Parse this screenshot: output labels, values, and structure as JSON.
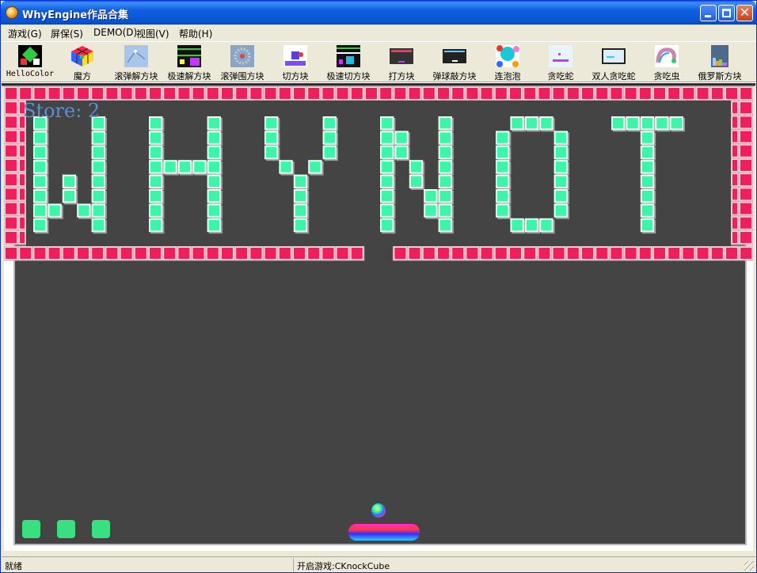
{
  "window": {
    "title": "WhyEngine作品合集"
  },
  "menu": [
    "游戏(G)",
    "屏保(S)",
    "DEMO(D)",
    "视图(V)",
    "帮助(H)"
  ],
  "toolbar": [
    {
      "label": "HelloColor",
      "icon": "hellocolor-icon"
    },
    {
      "label": "魔方",
      "icon": "rubik-cube-icon"
    },
    {
      "label": "滚弹解方块",
      "icon": "roll-ball-icon"
    },
    {
      "label": "极速解方块",
      "icon": "speed-solve-icon"
    },
    {
      "label": "滚弹围方块",
      "icon": "roll-surround-icon"
    },
    {
      "label": "切方块",
      "icon": "cut-cube-icon"
    },
    {
      "label": "极速切方块",
      "icon": "speed-cut-icon"
    },
    {
      "label": "打方块",
      "icon": "knock-cube-icon"
    },
    {
      "label": "弹球敲方块",
      "icon": "pinball-icon"
    },
    {
      "label": "连泡泡",
      "icon": "bubble-icon"
    },
    {
      "label": "贪吃蛇",
      "icon": "snake-icon"
    },
    {
      "label": "双人贪吃蛇",
      "icon": "two-player-snake-icon"
    },
    {
      "label": "贪吃虫",
      "icon": "worm-icon"
    },
    {
      "label": "俄罗斯方块",
      "icon": "tetris-icon"
    }
  ],
  "game": {
    "score_text": "Store: 2",
    "title_word": "WHYNOT",
    "lives": 3,
    "colors": {
      "background": "#444444",
      "border_brick": "#f01e5a",
      "letter_brick": "#3df5a6",
      "score": "#5b8fd6"
    }
  },
  "statusbar": {
    "left": "就绪",
    "right": "开启游戏:CKnockCube"
  }
}
